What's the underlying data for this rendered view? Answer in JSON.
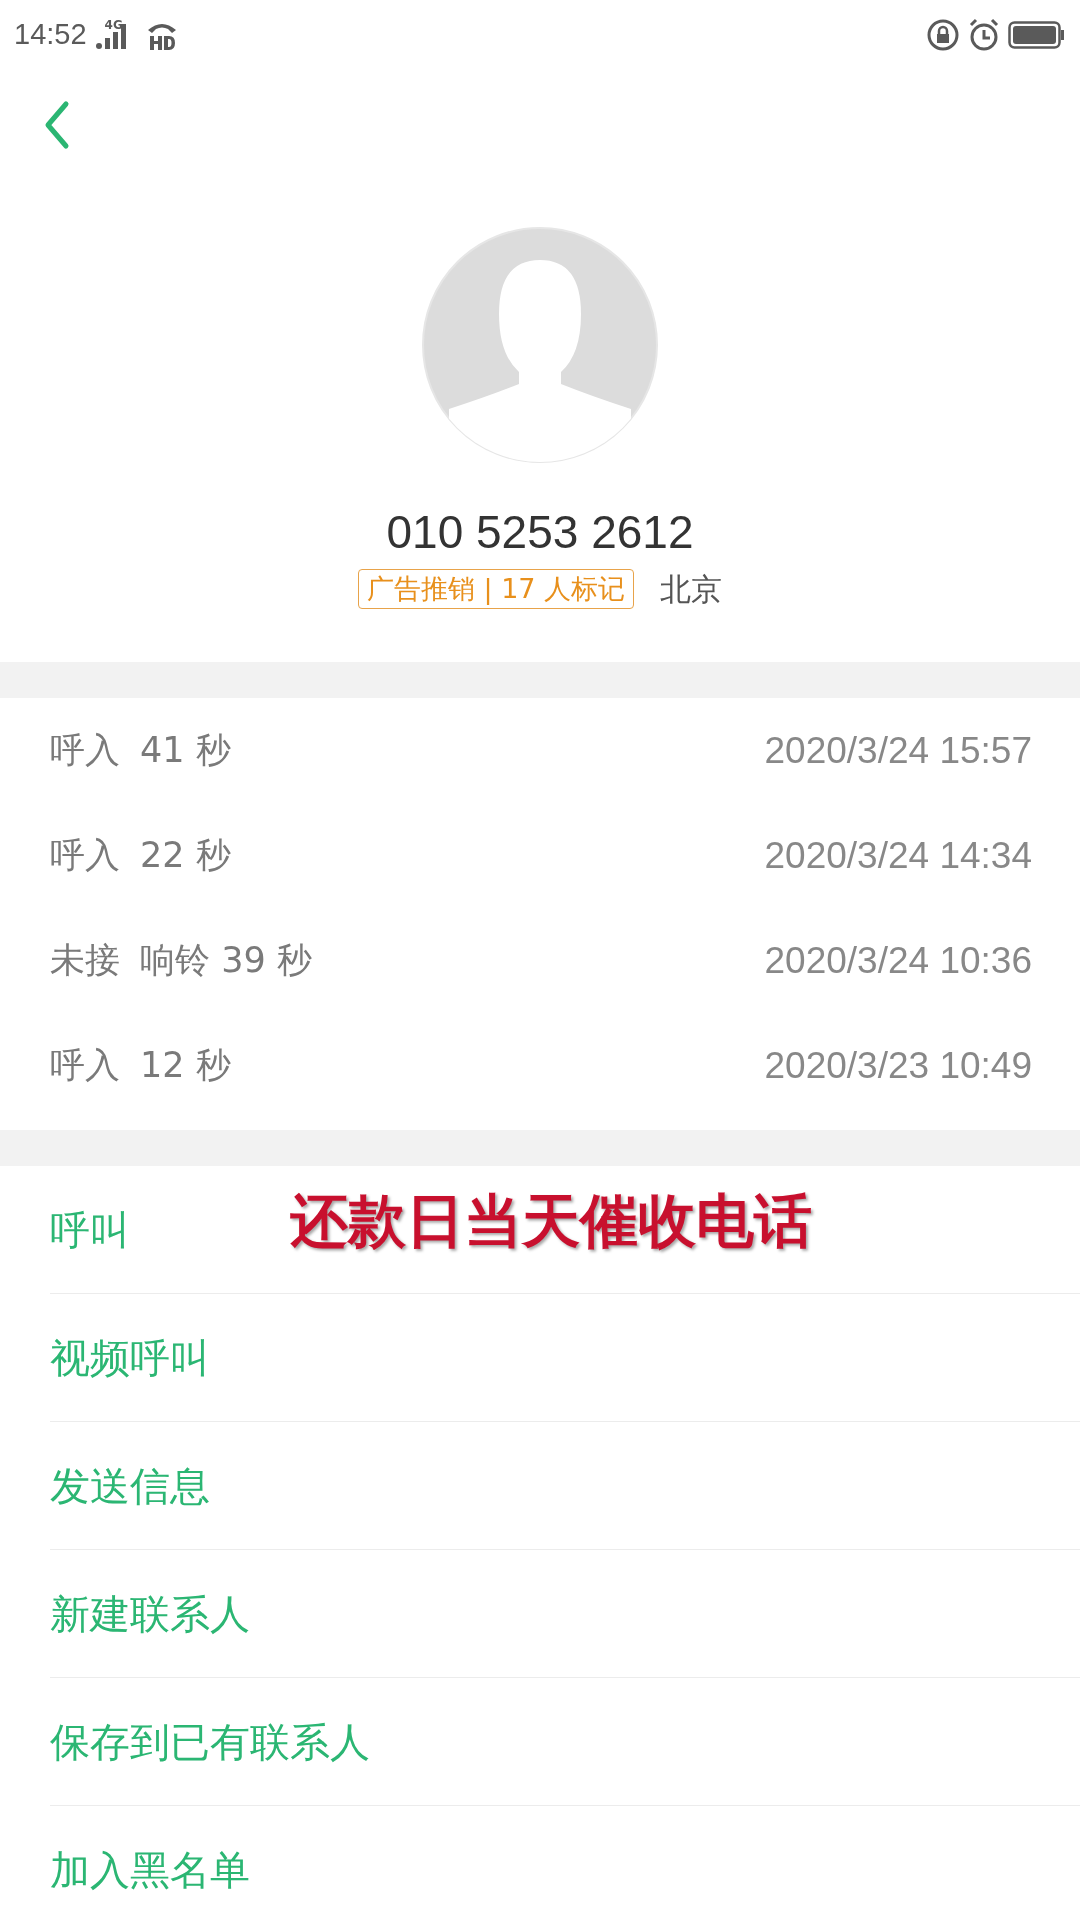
{
  "status_bar": {
    "time": "14:52",
    "network": "4G"
  },
  "contact": {
    "number": "010 5253 2612",
    "tag": "广告推销 | 17 人标记",
    "location": "北京"
  },
  "calls": [
    {
      "type": "呼入",
      "detail": "41 秒",
      "time": "2020/3/24 15:57"
    },
    {
      "type": "呼入",
      "detail": "22 秒",
      "time": "2020/3/24 14:34"
    },
    {
      "type": "未接",
      "detail": "响铃 39 秒",
      "time": "2020/3/24 10:36"
    },
    {
      "type": "呼入",
      "detail": "12 秒",
      "time": "2020/3/23 10:49"
    }
  ],
  "actions": [
    "呼叫",
    "视频呼叫",
    "发送信息",
    "新建联系人",
    "保存到已有联系人",
    "加入黑名单"
  ],
  "annotation": "还款日当天催收电话"
}
